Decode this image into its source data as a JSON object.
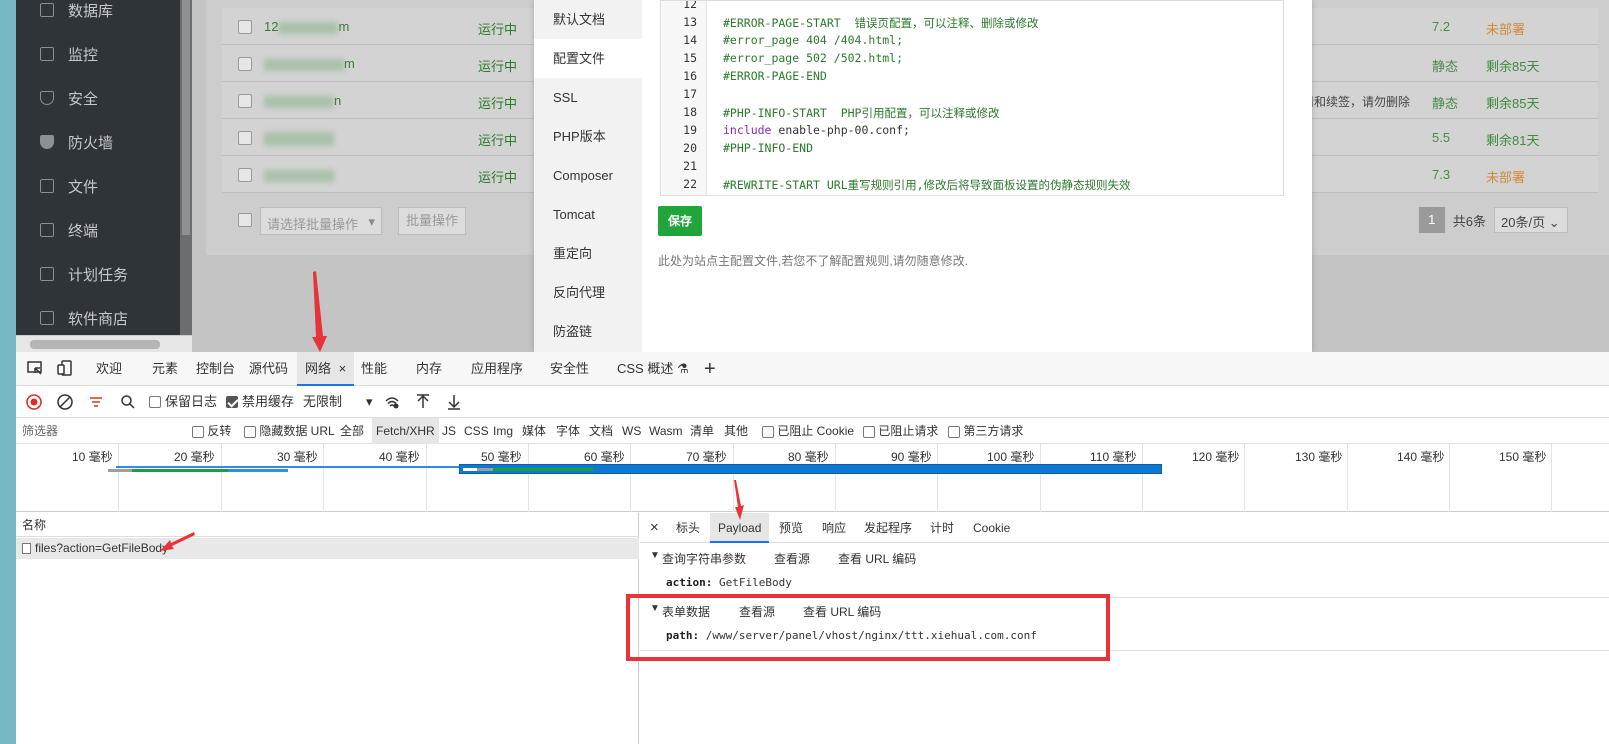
{
  "sidebar": {
    "items": [
      {
        "label": "数据库",
        "icon": "database-icon"
      },
      {
        "label": "监控",
        "icon": "monitor-icon"
      },
      {
        "label": "安全",
        "icon": "shield-icon"
      },
      {
        "label": "防火墙",
        "icon": "firewall-icon"
      },
      {
        "label": "文件",
        "icon": "folder-icon"
      },
      {
        "label": "终端",
        "icon": "terminal-icon"
      },
      {
        "label": "计划任务",
        "icon": "calendar-icon"
      },
      {
        "label": "软件商店",
        "icon": "store-icon"
      }
    ]
  },
  "sites": {
    "rows": [
      {
        "name": "12",
        "name_tail": "m",
        "status": "运行中",
        "php": "7.2",
        "expiry": "未部署",
        "expiry_color": "orange"
      },
      {
        "name": "",
        "name_tail": "m",
        "status": "运行中",
        "php": "静态",
        "expiry": "剩余85天",
        "expiry_color": "green"
      },
      {
        "name": "",
        "name_tail": "n",
        "status": "运行中",
        "php": "静态",
        "expiry": "剩余85天",
        "expiry_color": "green",
        "note": "书申请和续签，请勿删除"
      },
      {
        "name": "",
        "name_tail": "",
        "status": "运行中",
        "php": "5.5",
        "expiry": "剩余81天",
        "expiry_color": "green"
      },
      {
        "name": "",
        "name_tail": "",
        "status": "运行中",
        "php": "7.3",
        "expiry": "未部署",
        "expiry_color": "orange"
      }
    ],
    "batch_placeholder": "请选择批量操作",
    "batch_button": "批量操作",
    "page_current": "1",
    "total": "共6条",
    "per_page": "20条/页"
  },
  "modal": {
    "menu": [
      "默认文档",
      "配置文件",
      "SSL",
      "PHP版本",
      "Composer",
      "Tomcat",
      "重定向",
      "反向代理",
      "防盗链"
    ],
    "active_menu": "配置文件",
    "code_lines": [
      {
        "n": "12",
        "text": ""
      },
      {
        "n": "13",
        "text": "#ERROR-PAGE-START  错误页配置，可以注释、删除或修改"
      },
      {
        "n": "14",
        "text": "#error_page 404 /404.html;"
      },
      {
        "n": "15",
        "text": "#error_page 502 /502.html;"
      },
      {
        "n": "16",
        "text": "#ERROR-PAGE-END"
      },
      {
        "n": "17",
        "text": ""
      },
      {
        "n": "18",
        "text": "#PHP-INFO-START  PHP引用配置，可以注释或修改"
      },
      {
        "n": "19",
        "kw": "include",
        "text": " enable-php-00.conf;"
      },
      {
        "n": "20",
        "text": "#PHP-INFO-END"
      },
      {
        "n": "21",
        "text": ""
      },
      {
        "n": "22",
        "text": "#REWRITE-START URL重写规则引用,修改后将导致面板设置的伪静态规则失效"
      }
    ],
    "save_label": "保存",
    "note": "此处为站点主配置文件,若您不了解配置规则,请勿随意修改."
  },
  "devtools": {
    "tabs": [
      "欢迎",
      "元素",
      "控制台",
      "源代码",
      "网络",
      "性能",
      "内存",
      "应用程序",
      "安全性",
      "CSS 概述"
    ],
    "active_tab": "网络",
    "toolbar": {
      "preserve_log": "保留日志",
      "disable_cache": "禁用缓存",
      "throttle": "无限制"
    },
    "filter": {
      "placeholder": "筛选器",
      "invert": "反转",
      "hide_data_url": "隐藏数据 URL",
      "types": [
        "全部",
        "Fetch/XHR",
        "JS",
        "CSS",
        "Img",
        "媒体",
        "字体",
        "文档",
        "WS",
        "Wasm",
        "清单",
        "其他"
      ],
      "active_type": "Fetch/XHR",
      "blocked_cookies": "已阻止 Cookie",
      "blocked_requests": "已阻止请求",
      "third_party": "第三方请求"
    },
    "timeline_ticks": [
      "10 毫秒",
      "20 毫秒",
      "30 毫秒",
      "40 毫秒",
      "50 毫秒",
      "60 毫秒",
      "70 毫秒",
      "80 毫秒",
      "90 毫秒",
      "100 毫秒",
      "110 毫秒",
      "120 毫秒",
      "130 毫秒",
      "140 毫秒",
      "150 毫秒"
    ],
    "requests_header": "名称",
    "request_name": "files?action=GetFileBody",
    "detail_tabs": [
      "标头",
      "Payload",
      "预览",
      "响应",
      "发起程序",
      "计时",
      "Cookie"
    ],
    "active_detail_tab": "Payload",
    "query_section": {
      "title": "查询字符串参数",
      "view_source": "查看源",
      "view_url": "查看 URL 编码"
    },
    "query_key": "action:",
    "query_value": "GetFileBody",
    "form_section": {
      "title": "表单数据",
      "view_source": "查看源",
      "view_url": "查看 URL 编码"
    },
    "form_key": "path:",
    "form_value": "/www/server/panel/vhost/nginx/ttt.xiehual.com.conf"
  },
  "colors": {
    "annotation_red": "#e8333a",
    "save_green": "#20a53a",
    "devtools_blue": "#1a73e8"
  }
}
